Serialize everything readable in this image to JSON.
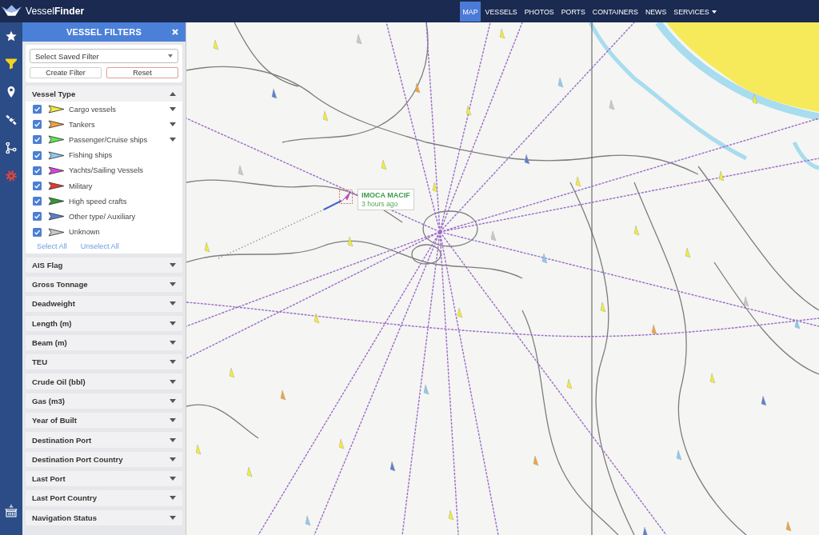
{
  "logo": {
    "text": "Vessel**Finder**"
  },
  "nav": [
    {
      "label": "MAP",
      "selected": true,
      "dropdown": false
    },
    {
      "label": "VESSELS",
      "selected": false,
      "dropdown": false
    },
    {
      "label": "PHOTOS",
      "selected": false,
      "dropdown": false
    },
    {
      "label": "PORTS",
      "selected": false,
      "dropdown": false
    },
    {
      "label": "CONTAINERS",
      "selected": false,
      "dropdown": false
    },
    {
      "label": "NEWS",
      "selected": false,
      "dropdown": false
    },
    {
      "label": "SERVICES",
      "selected": false,
      "dropdown": true
    }
  ],
  "rail_top": [
    {
      "kind": "star",
      "selected": false
    },
    {
      "kind": "filter",
      "selected": true
    },
    {
      "kind": "pin",
      "selected": false
    },
    {
      "kind": "satellite",
      "selected": false
    },
    {
      "kind": "route",
      "selected": false
    },
    {
      "kind": "gear",
      "selected": false
    }
  ],
  "rail_bottom": [
    {
      "kind": "port",
      "selected": false
    }
  ],
  "panel": {
    "title": "VESSEL FILTERS",
    "saved_filter": {
      "value": "Select Saved Filter"
    },
    "buttons": [
      {
        "label": "Create Filter",
        "kind": "default"
      },
      {
        "label": "Reset",
        "kind": "danger"
      }
    ]
  },
  "sections": [
    {
      "title": "Vessel Type",
      "expanded": true,
      "items": [
        {
          "label": "Cargo vessels",
          "checked": true,
          "color": "#f2ec38",
          "submenu": true
        },
        {
          "label": "Tankers",
          "checked": true,
          "color": "#f4a23e",
          "submenu": true
        },
        {
          "label": "Passenger/Cruise ships",
          "checked": true,
          "color": "#5ee84a",
          "submenu": true
        },
        {
          "label": "Fishing ships",
          "checked": true,
          "color": "#8ccaf4",
          "submenu": false
        },
        {
          "label": "Yachts/Sailing Vessels",
          "checked": true,
          "color": "#de3fe0",
          "submenu": false
        },
        {
          "label": "Military",
          "checked": true,
          "color": "#e6372d",
          "submenu": false
        },
        {
          "label": "High speed crafts",
          "checked": true,
          "color": "#2f9a30",
          "submenu": false
        },
        {
          "label": "Other type/ Auxiliary",
          "checked": true,
          "color": "#5a7fd2",
          "submenu": false
        },
        {
          "label": "Unknown",
          "checked": true,
          "color": "#c9c9c9",
          "submenu": false
        }
      ],
      "links": [
        {
          "label": "Select All"
        },
        {
          "label": "Unselect All"
        }
      ]
    },
    {
      "title": "AIS Flag",
      "expanded": false
    },
    {
      "title": "Gross Tonnage",
      "expanded": false
    },
    {
      "title": "Deadweight",
      "expanded": false
    },
    {
      "title": "Length (m)",
      "expanded": false
    },
    {
      "title": "Beam (m)",
      "expanded": false
    },
    {
      "title": "TEU",
      "expanded": false
    },
    {
      "title": "Crude Oil (bbl)",
      "expanded": false
    },
    {
      "title": "Gas (m3)",
      "expanded": false
    },
    {
      "title": "Year of Built",
      "expanded": false
    },
    {
      "title": "Destination Port",
      "expanded": false
    },
    {
      "title": "Destination Port Country",
      "expanded": false
    },
    {
      "title": "Last Port",
      "expanded": false
    },
    {
      "title": "Last Port Country",
      "expanded": false
    },
    {
      "title": "Navigation Status",
      "expanded": false
    }
  ],
  "map": {
    "popup": {
      "title": "IMOCA MACIF",
      "subtitle": "3 hours ago"
    }
  }
}
